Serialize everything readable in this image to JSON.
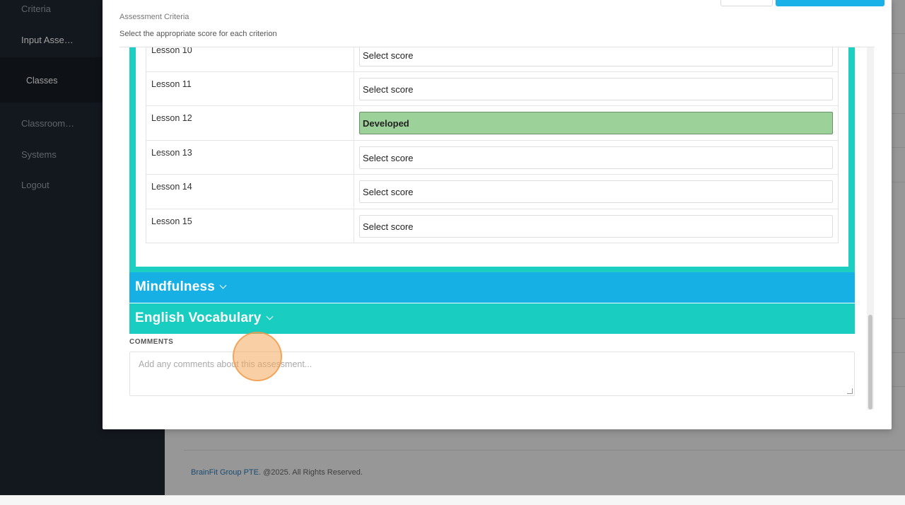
{
  "sidebar": {
    "items": [
      {
        "label": "Criteria"
      },
      {
        "label": "Input Asse…"
      },
      {
        "label": "Classes"
      },
      {
        "label": "Classroom…"
      },
      {
        "label": "Systems"
      },
      {
        "label": "Logout"
      }
    ]
  },
  "footer": {
    "brand": "BrainFit Group PTE.",
    "rights": " @2025. All Rights Reserved."
  },
  "modal": {
    "title": "Assessment Criteria",
    "subtitle": "Select the appropriate score for each criterion",
    "lessons": [
      {
        "name": "Lesson 10",
        "score": "Select score"
      },
      {
        "name": "Lesson 11",
        "score": "Select score"
      },
      {
        "name": "Lesson 12",
        "score": "Developed"
      },
      {
        "name": "Lesson 13",
        "score": "Select score"
      },
      {
        "name": "Lesson 14",
        "score": "Select score"
      },
      {
        "name": "Lesson 15",
        "score": "Select score"
      }
    ],
    "sections": [
      {
        "title": "Mindfulness"
      },
      {
        "title": "English Vocabulary"
      }
    ],
    "comments": {
      "label": "COMMENTS",
      "placeholder": "Add any comments about this assessment..."
    }
  },
  "colors": {
    "teal": "#1ccfc0",
    "blue": "#17b0e4",
    "developed": "#9dd19a",
    "sidebar": "#1f2631"
  }
}
